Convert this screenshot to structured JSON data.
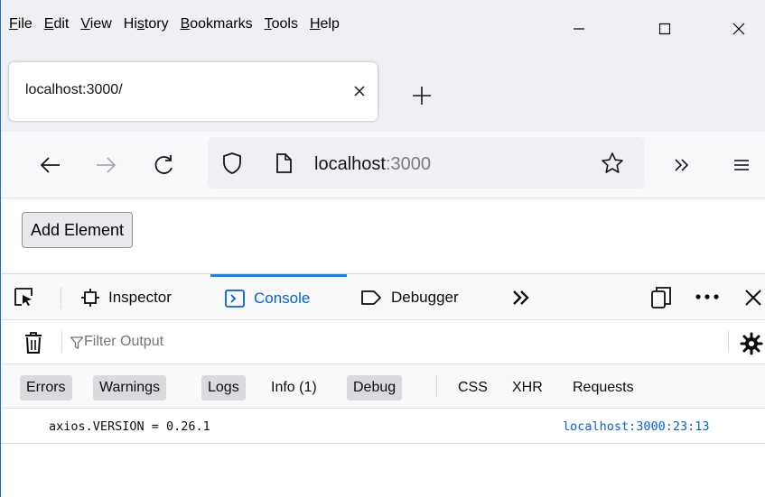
{
  "menu": [
    {
      "pre": "",
      "key": "F",
      "post": "ile"
    },
    {
      "pre": "",
      "key": "E",
      "post": "dit"
    },
    {
      "pre": "",
      "key": "V",
      "post": "iew"
    },
    {
      "pre": "Hi",
      "key": "s",
      "post": "tory"
    },
    {
      "pre": "",
      "key": "B",
      "post": "ookmarks"
    },
    {
      "pre": "",
      "key": "T",
      "post": "ools"
    },
    {
      "pre": "",
      "key": "H",
      "post": "elp"
    }
  ],
  "tab": {
    "title": "localhost:3000/"
  },
  "url": {
    "host": "localhost",
    "port": ":3000"
  },
  "page": {
    "add_button": "Add Element"
  },
  "devtools": {
    "tabs": {
      "inspector": "Inspector",
      "console": "Console",
      "debugger": "Debugger"
    },
    "filter_placeholder": "Filter Output",
    "levels": [
      {
        "label": "Errors",
        "on": true
      },
      {
        "label": "Warnings",
        "on": true
      },
      {
        "label": "Logs",
        "on": true
      },
      {
        "label": "Info (1)",
        "on": false
      },
      {
        "label": "Debug",
        "on": true
      },
      {
        "label": "CSS",
        "on": false
      },
      {
        "label": "XHR",
        "on": false
      },
      {
        "label": "Requests",
        "on": false
      }
    ],
    "message": "axios.VERSION = 0.26.1",
    "location": "localhost:3000:23:13"
  },
  "colors": {
    "accent": "#0a84ff",
    "link": "#0060df",
    "window_border": "#1f6fbf"
  }
}
